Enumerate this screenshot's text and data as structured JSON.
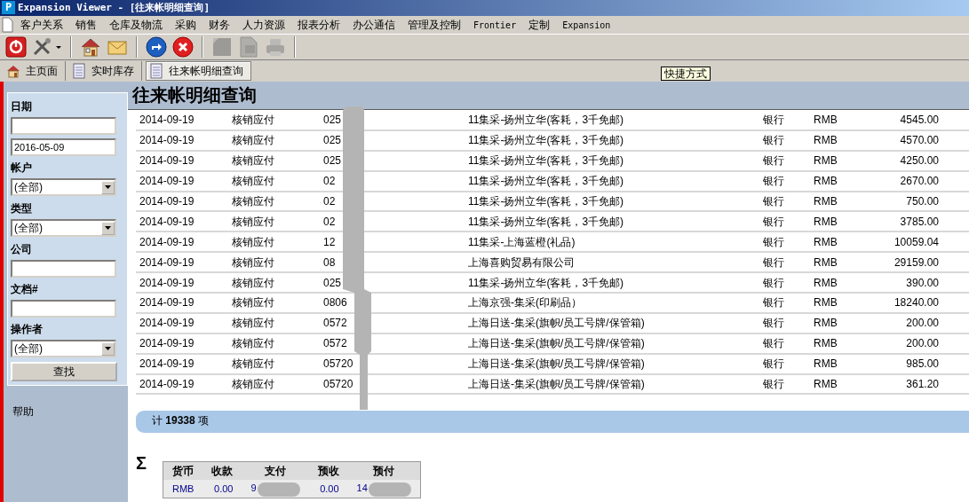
{
  "window": {
    "app_icon": "P",
    "title": "Expansion Viewer - [往来帐明细查询]"
  },
  "menu": [
    "客户关系",
    "销售",
    "仓库及物流",
    "采购",
    "财务",
    "人力资源",
    "报表分析",
    "办公通信",
    "管理及控制",
    "Frontier",
    "定制",
    "Expansion"
  ],
  "toolbar": [
    {
      "kind": "power",
      "disabled": false
    },
    {
      "kind": "tools",
      "disabled": false
    },
    {
      "kind": "sep"
    },
    {
      "kind": "home",
      "disabled": false
    },
    {
      "kind": "mail",
      "disabled": false
    },
    {
      "kind": "sep"
    },
    {
      "kind": "forward",
      "disabled": false
    },
    {
      "kind": "cancel",
      "disabled": false
    },
    {
      "kind": "sep"
    },
    {
      "kind": "square",
      "disabled": true
    },
    {
      "kind": "image",
      "disabled": true
    },
    {
      "kind": "printer",
      "disabled": true
    },
    {
      "kind": "sep"
    }
  ],
  "tabs": [
    {
      "label": "主页面",
      "selected": false
    },
    {
      "label": "实时库存",
      "selected": false
    },
    {
      "label": "往来帐明细查询",
      "selected": true
    }
  ],
  "tooltip": "快捷方式",
  "sidebar": {
    "fields": [
      {
        "kind": "heading",
        "label": "日期"
      },
      {
        "kind": "text"
      },
      {
        "kind": "text",
        "value": "2016-05-09"
      },
      {
        "kind": "heading",
        "label": "帐户"
      },
      {
        "kind": "select",
        "value": "(全部)"
      },
      {
        "kind": "heading",
        "label": "类型"
      },
      {
        "kind": "select",
        "value": "(全部)"
      },
      {
        "kind": "heading",
        "label": "公司"
      },
      {
        "kind": "text"
      },
      {
        "kind": "heading",
        "label": "文档#"
      },
      {
        "kind": "text"
      },
      {
        "kind": "heading",
        "label": "操作者"
      },
      {
        "kind": "select",
        "value": "(全部)"
      },
      {
        "kind": "button",
        "label": "查找"
      }
    ],
    "help": "帮助"
  },
  "page_title": "往来帐明细查询",
  "table": {
    "rows": [
      [
        "2014-09-19",
        "核销应付",
        "025",
        "11集采-扬州立华(客耗，3千免邮)",
        "银行",
        "RMB",
        "4545.00"
      ],
      [
        "2014-09-19",
        "核销应付",
        "025",
        "11集采-扬州立华(客耗，3千免邮)",
        "银行",
        "RMB",
        "4570.00"
      ],
      [
        "2014-09-19",
        "核销应付",
        "025",
        "11集采-扬州立华(客耗，3千免邮)",
        "银行",
        "RMB",
        "4250.00"
      ],
      [
        "2014-09-19",
        "核销应付",
        "02",
        "11集采-扬州立华(客耗，3千免邮)",
        "银行",
        "RMB",
        "2670.00"
      ],
      [
        "2014-09-19",
        "核销应付",
        "02",
        "11集采-扬州立华(客耗，3千免邮)",
        "银行",
        "RMB",
        "750.00"
      ],
      [
        "2014-09-19",
        "核销应付",
        "02",
        "11集采-扬州立华(客耗，3千免邮)",
        "银行",
        "RMB",
        "3785.00"
      ],
      [
        "2014-09-19",
        "核销应付",
        "12",
        "11集采-上海蓝橙(礼品)",
        "银行",
        "RMB",
        "10059.04"
      ],
      [
        "2014-09-19",
        "核销应付",
        "08",
        "上海喜购贸易有限公司",
        "银行",
        "RMB",
        "29159.00"
      ],
      [
        "2014-09-19",
        "核销应付",
        "025",
        "11集采-扬州立华(客耗，3千免邮)",
        "银行",
        "RMB",
        "390.00"
      ],
      [
        "2014-09-19",
        "核销应付",
        "0806",
        "上海京强-集采(印刷品）",
        "银行",
        "RMB",
        "18240.00"
      ],
      [
        "2014-09-19",
        "核销应付",
        "0572",
        "上海日送-集采(旗帜/员工号牌/保管箱)",
        "银行",
        "RMB",
        "200.00"
      ],
      [
        "2014-09-19",
        "核销应付",
        "0572",
        "上海日送-集采(旗帜/员工号牌/保管箱)",
        "银行",
        "RMB",
        "200.00"
      ],
      [
        "2014-09-19",
        "核销应付",
        "05720",
        "上海日送-集采(旗帜/员工号牌/保管箱)",
        "银行",
        "RMB",
        "985.00"
      ],
      [
        "2014-09-19",
        "核销应付",
        "05720",
        "上海日送-集采(旗帜/员工号牌/保管箱)",
        "银行",
        "RMB",
        "361.20"
      ]
    ]
  },
  "total": "计 **19338** 项",
  "summary": {
    "symbol": "Σ",
    "columns": [
      "货币",
      "收款",
      "支付",
      "预收",
      "预付"
    ],
    "rows": [
      [
        "RMB",
        "0.00",
        "9",
        "0.00",
        "14"
      ]
    ]
  }
}
